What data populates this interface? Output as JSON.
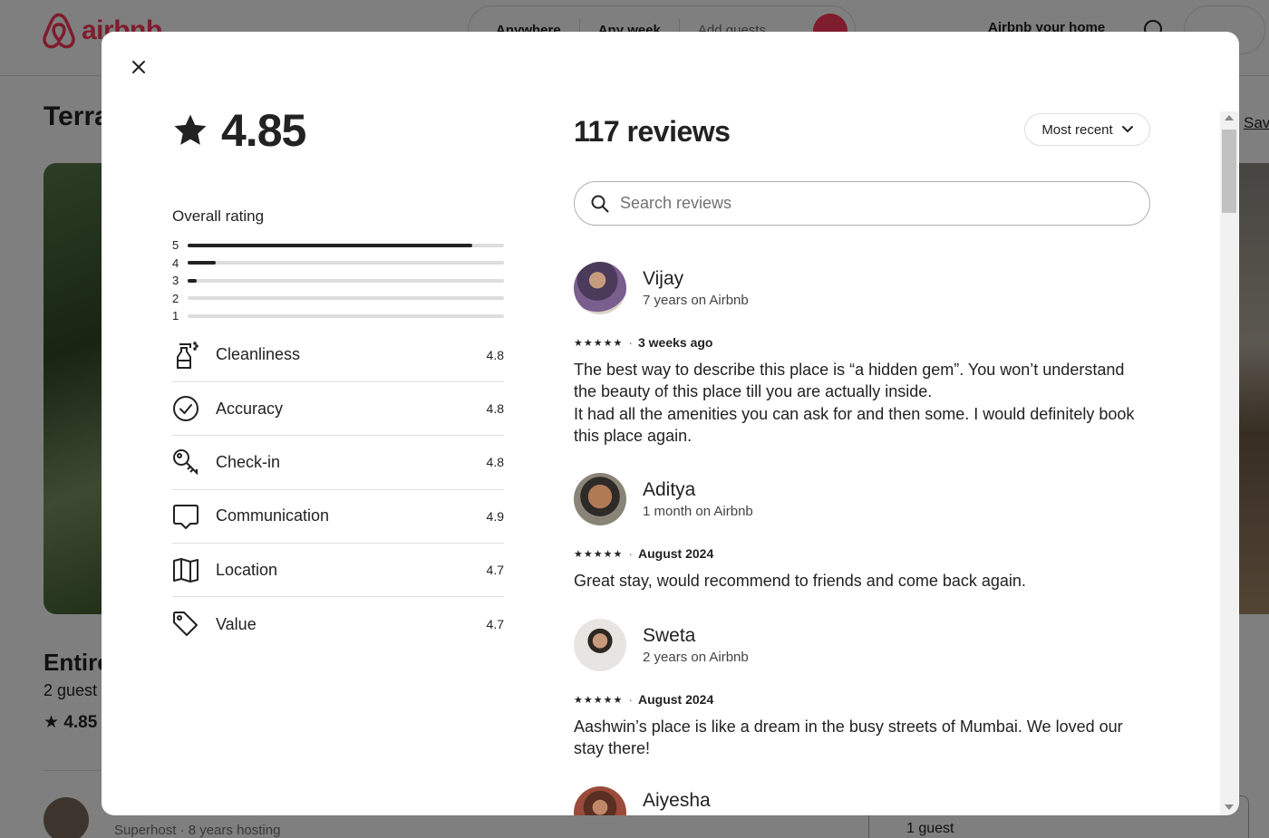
{
  "background": {
    "logo_text": "airbnb",
    "search": {
      "anywhere": "Anywhere",
      "any_week": "Any week",
      "add_guests": "Add guests"
    },
    "host_link": "Airbnb your home",
    "title": "Terra",
    "save_link": "Sav",
    "subtitle": "Entire",
    "guests": "2 guest",
    "rating": "4.85",
    "superhost": "Superhost · 8 years hosting",
    "booking_guests": "1 guest"
  },
  "modal": {
    "rating": "4.85",
    "overall_label": "Overall rating",
    "distribution": [
      {
        "stars": "5",
        "fraction": 0.9
      },
      {
        "stars": "4",
        "fraction": 0.09
      },
      {
        "stars": "3",
        "fraction": 0.03
      },
      {
        "stars": "2",
        "fraction": 0
      },
      {
        "stars": "1",
        "fraction": 0
      }
    ],
    "categories": [
      {
        "label": "Cleanliness",
        "value": "4.8",
        "icon": "spray-bottle-icon"
      },
      {
        "label": "Accuracy",
        "value": "4.8",
        "icon": "check-circle-icon"
      },
      {
        "label": "Check-in",
        "value": "4.8",
        "icon": "key-icon"
      },
      {
        "label": "Communication",
        "value": "4.9",
        "icon": "chat-bubble-icon"
      },
      {
        "label": "Location",
        "value": "4.7",
        "icon": "map-icon"
      },
      {
        "label": "Value",
        "value": "4.7",
        "icon": "tag-icon"
      }
    ],
    "reviews_count": "117 reviews",
    "sort_label": "Most recent",
    "search_placeholder": "Search reviews",
    "reviews": [
      {
        "name": "Vijay",
        "tenure": "7 years on Airbnb",
        "stars": "★★★★★",
        "date": "3 weeks ago",
        "text": "The best way to describe this place is “a hidden gem”. You won’t understand the beauty of this place till you are actually inside.\nIt had all the amenities you can ask for and then some. I would definitely book this place again."
      },
      {
        "name": "Aditya",
        "tenure": "1 month on Airbnb",
        "stars": "★★★★★",
        "date": "August 2024",
        "text": "Great stay, would recommend to friends and come back again."
      },
      {
        "name": "Sweta",
        "tenure": "2 years on Airbnb",
        "stars": "★★★★★",
        "date": "August 2024",
        "text": "Aashwin’s place is like a dream in the busy streets of Mumbai. We loved our stay there!"
      },
      {
        "name": "Aiyesha",
        "tenure": "",
        "stars": "",
        "date": "",
        "text": ""
      }
    ]
  }
}
